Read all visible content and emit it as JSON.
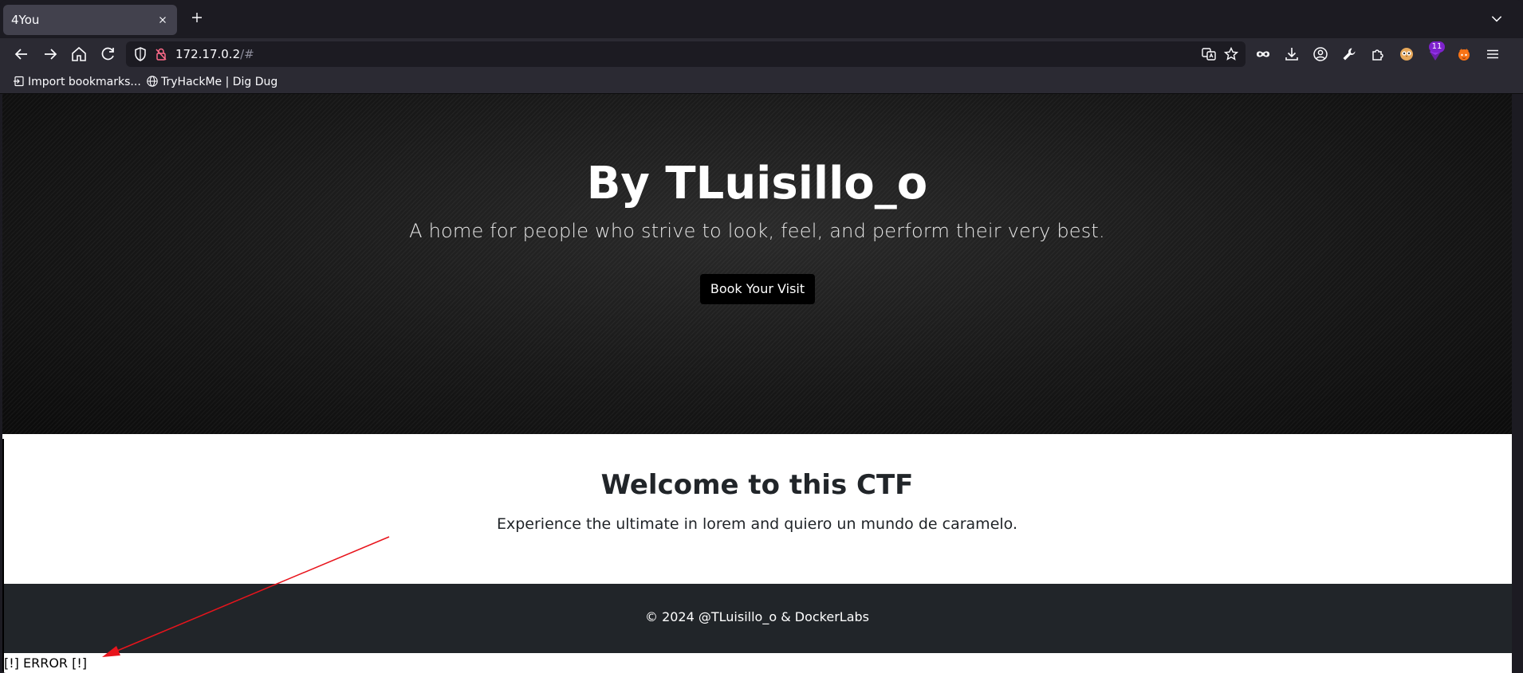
{
  "browser": {
    "tab": {
      "title": "4You",
      "close_icon": "close-icon"
    },
    "new_tab_icon": "plus-icon",
    "url": {
      "host": "172.17.0.2",
      "path": "/#"
    },
    "bookmarks": [
      {
        "label": "Import bookmarks...",
        "icon": "import-icon"
      },
      {
        "label": "TryHackMe | Dig Dug",
        "icon": "globe-icon"
      }
    ],
    "extension_badge": "11"
  },
  "hero": {
    "title": "By TLuisillo_o",
    "subtitle": "A home for people who strive to look, feel, and perform their very best.",
    "button_label": "Book Your Visit"
  },
  "welcome": {
    "title": "Welcome to this CTF",
    "text": "Experience the ultimate in lorem and quiero un mundo de caramelo."
  },
  "footer": {
    "text": "© 2024 @TLuisillo_o & DockerLabs"
  },
  "error": {
    "text": "[!] ERROR [!]"
  },
  "colors": {
    "browser_bg": "#1c1b22",
    "toolbar_bg": "#2b2a33",
    "hero_bg": "#151515",
    "footer_bg": "#212529",
    "annotation_arrow": "#e8141c"
  }
}
